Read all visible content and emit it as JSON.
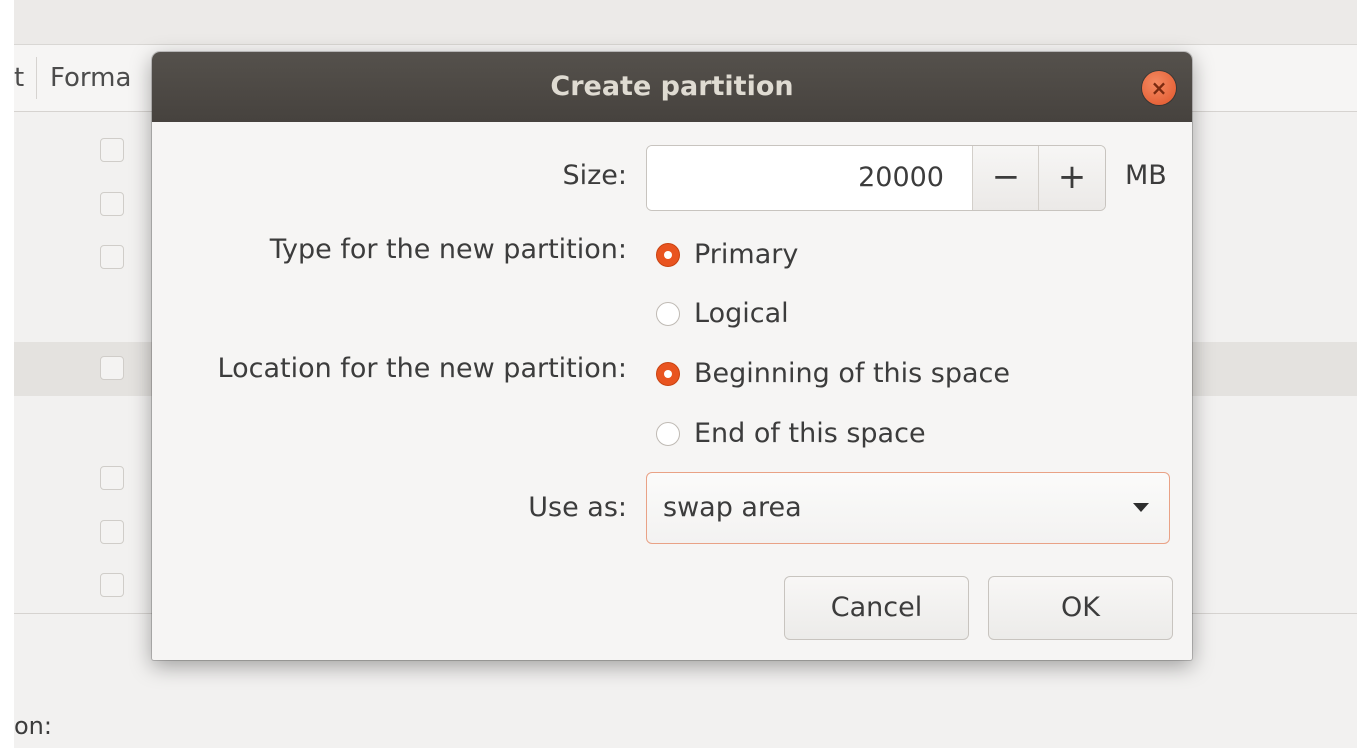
{
  "background": {
    "header_partial_left": "t",
    "header_partial_format": "Forma",
    "footer_partial_label": "on:"
  },
  "dialog": {
    "title": "Create partition",
    "close_icon": "close-icon",
    "size": {
      "label": "Size:",
      "value": "20000",
      "decrement": "−",
      "increment": "+",
      "unit": "MB"
    },
    "type": {
      "label": "Type for the new partition:",
      "options": [
        {
          "label": "Primary",
          "selected": true
        },
        {
          "label": "Logical",
          "selected": false
        }
      ]
    },
    "location": {
      "label": "Location for the new partition:",
      "options": [
        {
          "label": "Beginning of this space",
          "selected": true
        },
        {
          "label": "End of this space",
          "selected": false
        }
      ]
    },
    "use_as": {
      "label": "Use as:",
      "value": "swap area"
    },
    "buttons": {
      "cancel": "Cancel",
      "ok": "OK"
    }
  },
  "colors": {
    "accent": "#e95420",
    "titlebar": "#4d4945",
    "title_text": "#dfdbd2"
  }
}
